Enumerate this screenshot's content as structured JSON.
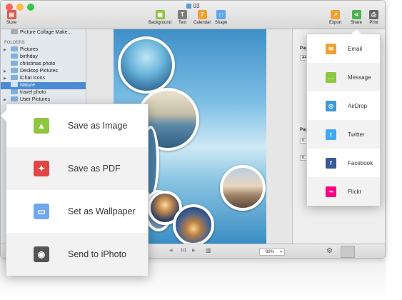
{
  "window": {
    "title": "03"
  },
  "toolbar": {
    "store": "Store",
    "background": "Background",
    "text": "Text",
    "calendar": "Calendar",
    "calendar_glyph": "7",
    "shape": "Shape",
    "export": "Export",
    "share": "Share",
    "print": "Print"
  },
  "sidebar": {
    "top_item": "Picture Collage Make...",
    "folders_header": "FOLDERS",
    "items": [
      "Pictures",
      "birthday",
      "christmas photo",
      "Desktop Pictures",
      "iChat Icons",
      "Nature",
      "travel photo",
      "User Pictures"
    ]
  },
  "right_panel": {
    "page_label_1": "Pag",
    "field_1": "A4",
    "page_label_2": "Pag",
    "field_2": "0.",
    "field_3": "0."
  },
  "bottom": {
    "page_indicator": "1/1",
    "zoom": "88%"
  },
  "save_menu": {
    "items": [
      {
        "label": "Save as Image",
        "icon": "image-icon",
        "color": "#8dc63f"
      },
      {
        "label": "Save as PDF",
        "icon": "pdf-icon",
        "color": "#e24444"
      },
      {
        "label": "Set as Wallpaper",
        "icon": "monitor-icon",
        "color": "#6fa8f0"
      },
      {
        "label": "Send to iPhoto",
        "icon": "camera-icon",
        "color": "#555555"
      }
    ]
  },
  "share_menu": {
    "items": [
      {
        "label": "Email",
        "icon": "email-icon",
        "color": "#f0a030"
      },
      {
        "label": "Message",
        "icon": "message-icon",
        "color": "#8dc63f"
      },
      {
        "label": "AirDrop",
        "icon": "airdrop-icon",
        "color": "#3b9ad9"
      },
      {
        "label": "Twitter",
        "icon": "twitter-icon",
        "color": "#3fa9f5"
      },
      {
        "label": "Facebook",
        "icon": "facebook-icon",
        "color": "#3b5998"
      },
      {
        "label": "Flickr",
        "icon": "flickr-icon",
        "color": "#ff0084"
      }
    ]
  }
}
